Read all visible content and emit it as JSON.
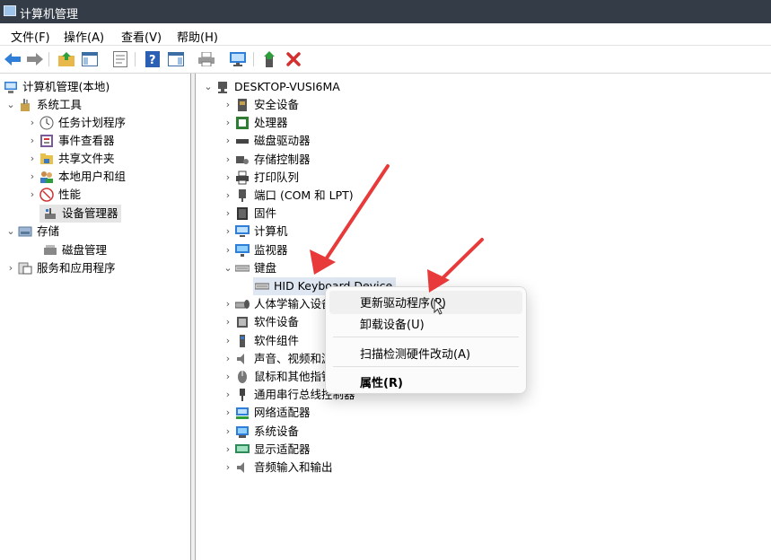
{
  "window": {
    "title": "计算机管理"
  },
  "menu": [
    "文件(F)",
    "操作(A)",
    "查看(V)",
    "帮助(H)"
  ],
  "toolbar": {
    "buttons": [
      "back-icon",
      "forward-icon",
      "up-folder-icon",
      "show-hide-tree-icon",
      "properties-icon",
      "help-icon",
      "action-pane-icon",
      "print-icon",
      "monitor-icon",
      "update-driver-icon",
      "delete-icon"
    ],
    "colors": {
      "arrow": "#2f7ed8",
      "delete": "#d32f2f"
    }
  },
  "left_tree": {
    "root": "计算机管理(本地)",
    "system_tools": "系统工具",
    "task_scheduler": "任务计划程序",
    "event_viewer": "事件查看器",
    "shared_folders": "共享文件夹",
    "local_users": "本地用户和组",
    "performance": "性能",
    "device_manager": "设备管理器",
    "storage": "存储",
    "disk_management": "磁盘管理",
    "services_apps": "服务和应用程序"
  },
  "device_tree": {
    "computer_name": "DESKTOP-VUSI6MA",
    "categories": [
      {
        "label": "安全设备",
        "icon": "security-device-icon"
      },
      {
        "label": "处理器",
        "icon": "processor-icon"
      },
      {
        "label": "磁盘驱动器",
        "icon": "disk-drive-icon"
      },
      {
        "label": "存储控制器",
        "icon": "storage-controller-icon"
      },
      {
        "label": "打印队列",
        "icon": "printer-icon"
      },
      {
        "label": "端口 (COM 和 LPT)",
        "icon": "port-icon"
      },
      {
        "label": "固件",
        "icon": "firmware-icon"
      },
      {
        "label": "计算机",
        "icon": "computer-icon"
      },
      {
        "label": "监视器",
        "icon": "monitor-icon"
      },
      {
        "label": "键盘",
        "icon": "keyboard-icon",
        "expanded": true
      },
      {
        "label": "HID Keyboard Device",
        "icon": "keyboard-icon",
        "child": true
      },
      {
        "label": "人体学输入设备",
        "icon": "hid-icon"
      },
      {
        "label": "软件设备",
        "icon": "software-device-icon"
      },
      {
        "label": "软件组件",
        "icon": "software-component-icon"
      },
      {
        "label": "声音、视频和游戏控制器",
        "icon": "sound-icon"
      },
      {
        "label": "鼠标和其他指针设备",
        "icon": "mouse-icon"
      },
      {
        "label": "通用串行总线控制器",
        "icon": "usb-icon"
      },
      {
        "label": "网络适配器",
        "icon": "network-adapter-icon"
      },
      {
        "label": "系统设备",
        "icon": "system-device-icon"
      },
      {
        "label": "显示适配器",
        "icon": "display-adapter-icon"
      },
      {
        "label": "音频输入和输出",
        "icon": "audio-io-icon"
      }
    ]
  },
  "context_menu": {
    "update_driver": "更新驱动程序(P)",
    "uninstall": "卸载设备(U)",
    "scan": "扫描检测硬件改动(A)",
    "properties": "属性(R)"
  },
  "annotation_color": "#e83a3a"
}
